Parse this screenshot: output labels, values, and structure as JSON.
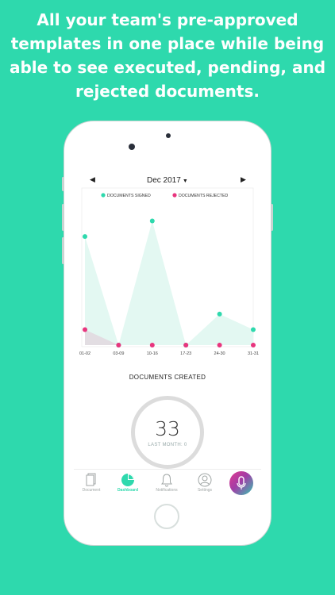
{
  "headline": {
    "line1": "All your team's pre-approved",
    "line2": "templates in one place while being",
    "line3": "able to see executed, pending, and",
    "line4": "rejected documents."
  },
  "month": {
    "label": "Dec 2017",
    "prev_icon": "triangle-left-icon",
    "next_icon": "triangle-right-icon"
  },
  "chart_data": {
    "type": "line",
    "categories": [
      "01-02",
      "03-09",
      "10-16",
      "17-23",
      "24-30",
      "31-31"
    ],
    "series": [
      {
        "name": "DOCUMENTS SIGNED",
        "color": "#2ed9ad",
        "fill": "#e3f8f2",
        "values": [
          7,
          0,
          8,
          0,
          2,
          1
        ]
      },
      {
        "name": "DOCUMENTS REJECTED",
        "color": "#e8357e",
        "fill": "#e2dde2",
        "values": [
          1,
          0,
          0,
          0,
          0,
          0
        ]
      }
    ],
    "legend": "top",
    "ylim": [
      0,
      9
    ],
    "grid": false
  },
  "documents_created": {
    "title": "DOCUMENTS CREATED",
    "value": "33",
    "last_month": "LAST MONTH: 0"
  },
  "tabs": [
    {
      "label": "Document",
      "icon": "document-icon",
      "active": false
    },
    {
      "label": "Dashboard",
      "icon": "pie-chart-icon",
      "active": true
    },
    {
      "label": "Notifications",
      "icon": "bell-icon",
      "active": false
    },
    {
      "label": "Settings",
      "icon": "user-icon",
      "active": false
    }
  ],
  "mic_button": {
    "icon": "microphone-icon"
  },
  "colors": {
    "accent": "#2ed9ad",
    "rejected": "#e8357e",
    "background": "#2ed9ad"
  }
}
